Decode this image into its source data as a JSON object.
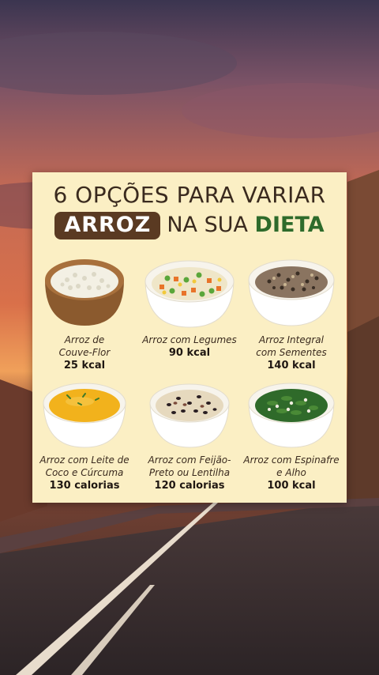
{
  "title": {
    "line1": "6 OPÇÕES PARA VARIAR",
    "highlight": "ARROZ",
    "middle": "NA SUA",
    "accent": "DIETA"
  },
  "colors": {
    "card": "#fbefc4",
    "pill": "#5a3a22",
    "accent": "#2e6b2b"
  },
  "options": [
    {
      "name_line1": "Arroz de",
      "name_line2": "Couve-Flor",
      "calories": "25 kcal",
      "icon": "cauliflower-rice-bowl"
    },
    {
      "name_line1": "Arroz com Legumes",
      "name_line2": "",
      "calories": "90 kcal",
      "icon": "vegetable-rice-bowl"
    },
    {
      "name_line1": "Arroz Integral",
      "name_line2": "com Sementes",
      "calories": "140 kcal",
      "icon": "brown-rice-seeds-bowl"
    },
    {
      "name_line1": "Arroz com Leite de",
      "name_line2": "Coco e Cúrcuma",
      "calories": "130 calorias",
      "icon": "coconut-turmeric-rice-bowl"
    },
    {
      "name_line1": "Arroz com Feijão-",
      "name_line2": "Preto ou Lentilha",
      "calories": "120 calorias",
      "icon": "black-bean-rice-bowl"
    },
    {
      "name_line1": "Arroz com Espinafre",
      "name_line2": "e Alho",
      "calories": "100 kcal",
      "icon": "spinach-garlic-rice-bowl"
    }
  ]
}
